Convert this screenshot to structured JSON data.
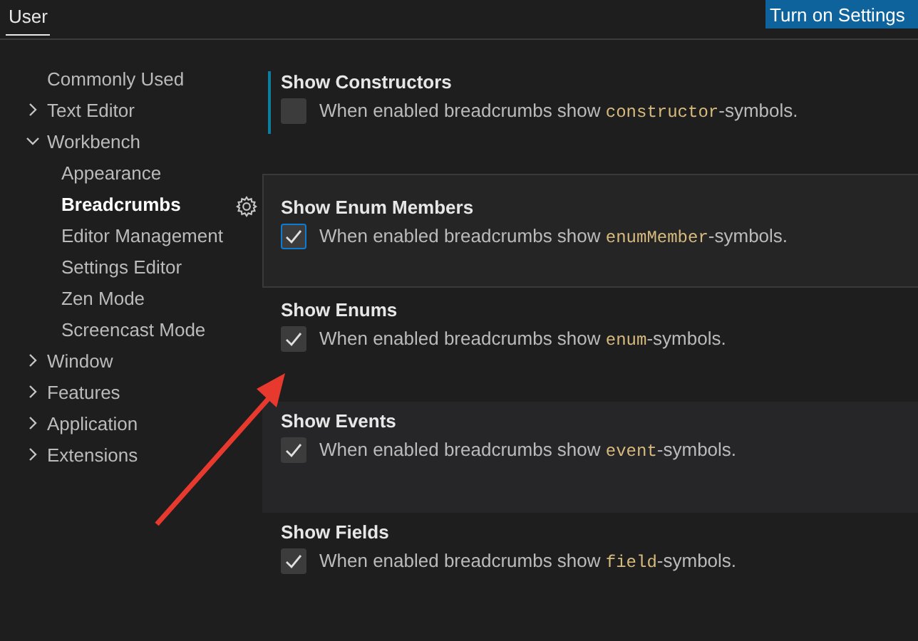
{
  "tabs": [
    {
      "label": "User",
      "selected": true
    }
  ],
  "sync_button": {
    "label": "Turn on Settings"
  },
  "toc": [
    {
      "label": "Commonly Used",
      "selected": false
    },
    {
      "label": "Text Editor",
      "expanded": false,
      "selected": false
    },
    {
      "label": "Workbench",
      "expanded": true,
      "selected": false,
      "children": [
        {
          "label": "Appearance",
          "selected": false
        },
        {
          "label": "Breadcrumbs",
          "selected": true
        },
        {
          "label": "Editor Management",
          "selected": false
        },
        {
          "label": "Settings Editor",
          "selected": false
        },
        {
          "label": "Zen Mode",
          "selected": false
        },
        {
          "label": "Screencast Mode",
          "selected": false
        }
      ]
    },
    {
      "label": "Window",
      "expanded": false,
      "selected": false
    },
    {
      "label": "Features",
      "expanded": false,
      "selected": false
    },
    {
      "label": "Application",
      "expanded": false,
      "selected": false
    },
    {
      "label": "Extensions",
      "expanded": false,
      "selected": false
    }
  ],
  "settings": [
    {
      "title": "Show Constructors",
      "prefix": "When enabled breadcrumbs show ",
      "code": "constructor",
      "suffix": "-symbols.",
      "checked": false,
      "modified": true,
      "focused": false,
      "hovered": false
    },
    {
      "title": "Show Enum Members",
      "prefix": "When enabled breadcrumbs show ",
      "code": "enumMember",
      "suffix": "-symbols.",
      "checked": true,
      "modified": false,
      "focused": true,
      "hovered": false
    },
    {
      "title": "Show Enums",
      "prefix": "When enabled breadcrumbs show ",
      "code": "enum",
      "suffix": "-symbols.",
      "checked": true,
      "modified": false,
      "focused": false,
      "hovered": false
    },
    {
      "title": "Show Events",
      "prefix": "When enabled breadcrumbs show ",
      "code": "event",
      "suffix": "-symbols.",
      "checked": true,
      "modified": false,
      "focused": false,
      "hovered": true
    },
    {
      "title": "Show Fields",
      "prefix": "When enabled breadcrumbs show ",
      "code": "field",
      "suffix": "-symbols.",
      "checked": true,
      "modified": false,
      "focused": false,
      "hovered": false
    }
  ]
}
